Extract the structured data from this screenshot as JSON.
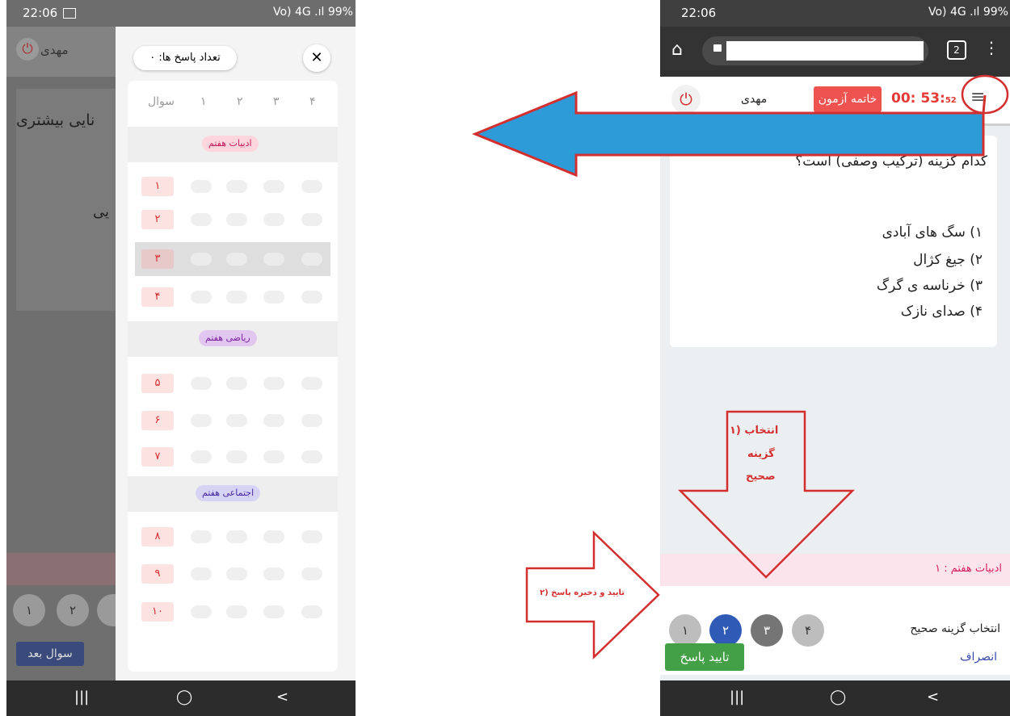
{
  "left_phone": {
    "status": {
      "time": "22:06",
      "right": "Vo) 4G .ıl 99%"
    },
    "header": {
      "user": "مهدی"
    },
    "bg_text": {
      "line1": "نایی بیشتری",
      "line2": "یی"
    },
    "bg_circles": [
      "۱",
      "۲"
    ],
    "next_button": "سوال بعد",
    "panel": {
      "answer_count": "تعداد پاسخ ها: ۰",
      "close_symbol": "✕",
      "col_header": [
        "سوال",
        "۱",
        "۲",
        "۳",
        "۴"
      ],
      "sections": [
        {
          "tag": "ادبیات هفتم",
          "questions": [
            "۱",
            "۲",
            "۳",
            "۴"
          ]
        },
        {
          "tag": "ریاضی هفتم",
          "questions": [
            "۵",
            "۶",
            "۷"
          ]
        },
        {
          "tag": "اجتماعی هفتم",
          "questions": [
            "۸",
            "۹",
            "۱۰"
          ]
        }
      ]
    },
    "nav": [
      "|||",
      "◯",
      "<"
    ]
  },
  "right_phone": {
    "status": {
      "time": "22:06",
      "right": "Vo) 4G .ıl 99%"
    },
    "urlbar": {
      "tabs": "2"
    },
    "appbar": {
      "user": "مهدی",
      "end_exam": "خاتمه آزمون",
      "timer_main": "00: 53:",
      "timer_sec": "52"
    },
    "question": "کدام گزینه (ترکیب وصفی) است؟",
    "options": [
      "۱)  سگ های آبادی",
      "۲)  جیغ کژال",
      "۳)  خرناسه ی گرگ",
      "۴)  صدای نازک"
    ],
    "section_bar": "ادبیات هفتم : ۱",
    "choose_label": "انتخاب گزینه صحیح",
    "choices": [
      "۱",
      "۲",
      "۳",
      "۴"
    ],
    "selected_choice": "۲",
    "confirm_button": "تایید پاسخ",
    "cancel_link": "انصراف",
    "nav": [
      "|||",
      "◯",
      "<"
    ]
  },
  "annotations": {
    "down_arrow_text": [
      "۱) انتخاب",
      "گزینه",
      "صحیح"
    ],
    "right_arrow_text": "۲) تایید و ذخیره پاسخ"
  },
  "colors": {
    "accent_blue": "#2f5bb7",
    "red": "#e53935",
    "annotation_red": "#d32f2f",
    "arrow_blue": "#2d9bd8"
  }
}
